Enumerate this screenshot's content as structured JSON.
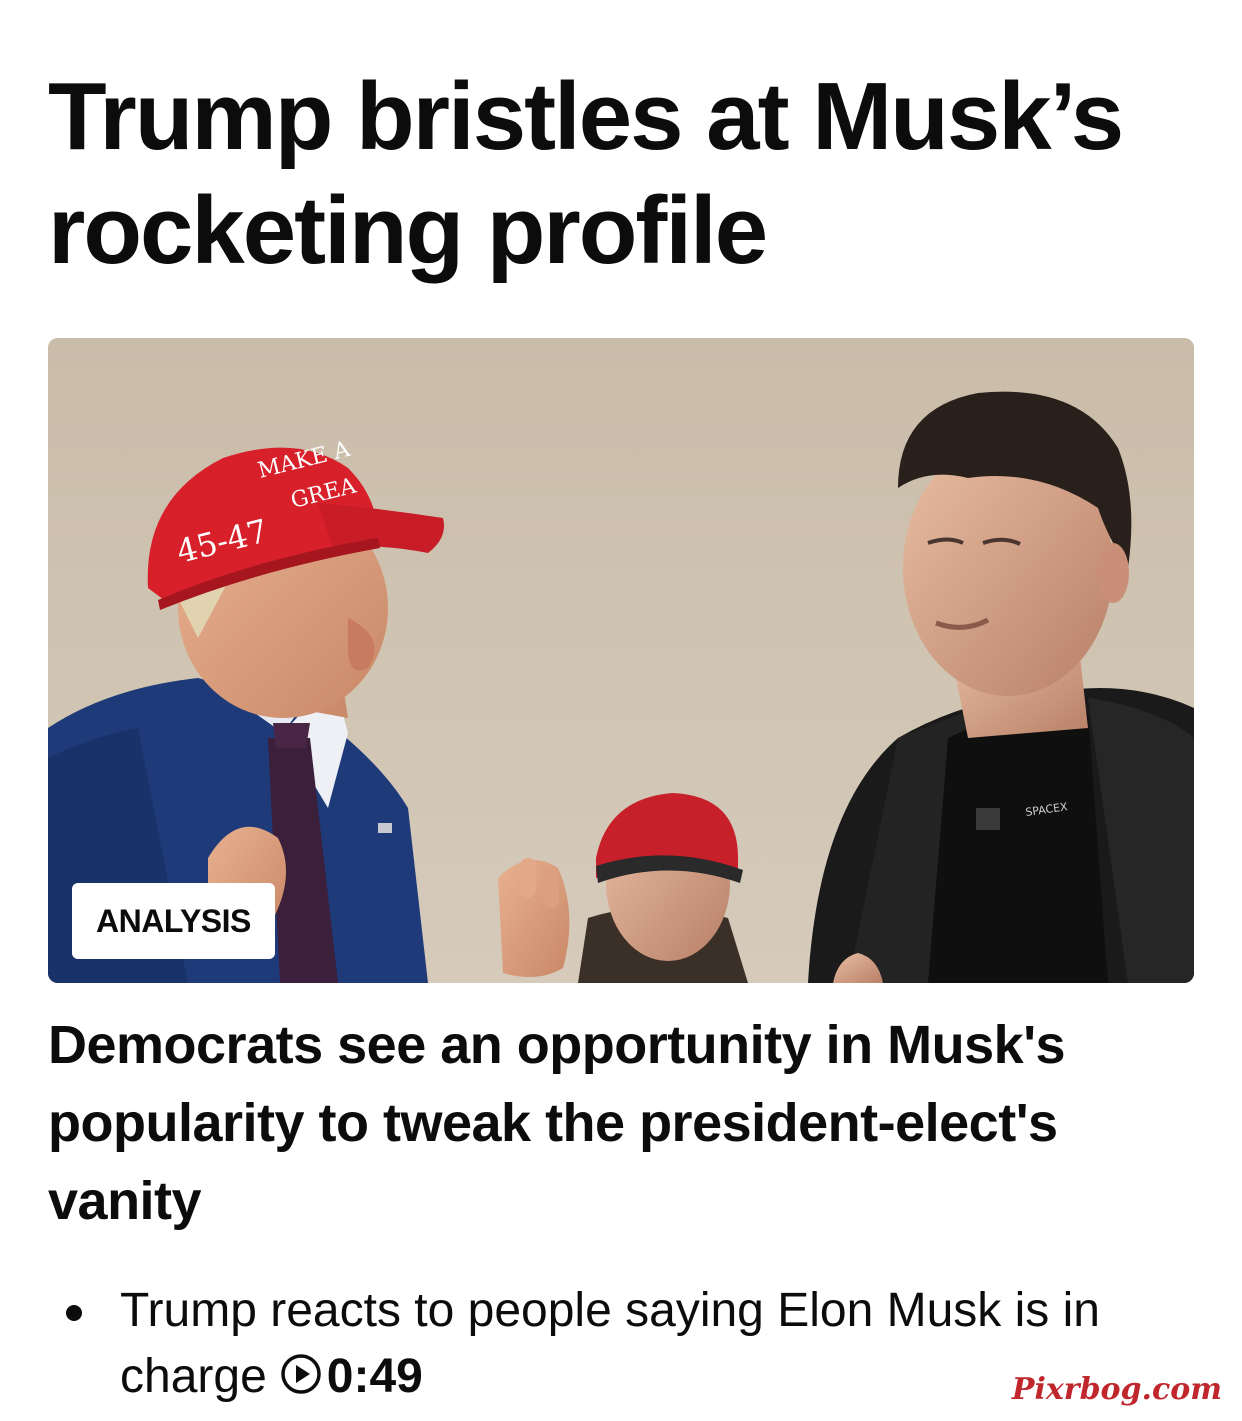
{
  "article": {
    "headline": "Trump bristles at Musk’s rocketing profile",
    "image": {
      "alt": "",
      "badge": "ANALYSIS",
      "cap_front_text": "45-47",
      "cap_top_text_1": "MAKE A",
      "cap_top_text_2": "GREA",
      "shirt_text": "SPACEX"
    },
    "subheadline": "Democrats see an opportunity in Musk's popularity to tweak the president-elect's vanity",
    "related": [
      {
        "title": "Trump reacts to people saying Elon Musk is in charge",
        "icon": "play-circle-icon",
        "duration": "0:49"
      }
    ]
  },
  "watermark": "Pixrbog.com",
  "colors": {
    "text": "#0c0c0c",
    "cap_red": "#d8202a",
    "suit_blue": "#1e3a78",
    "background_wall": "#cfc3b1",
    "watermark": "#c0272d"
  }
}
